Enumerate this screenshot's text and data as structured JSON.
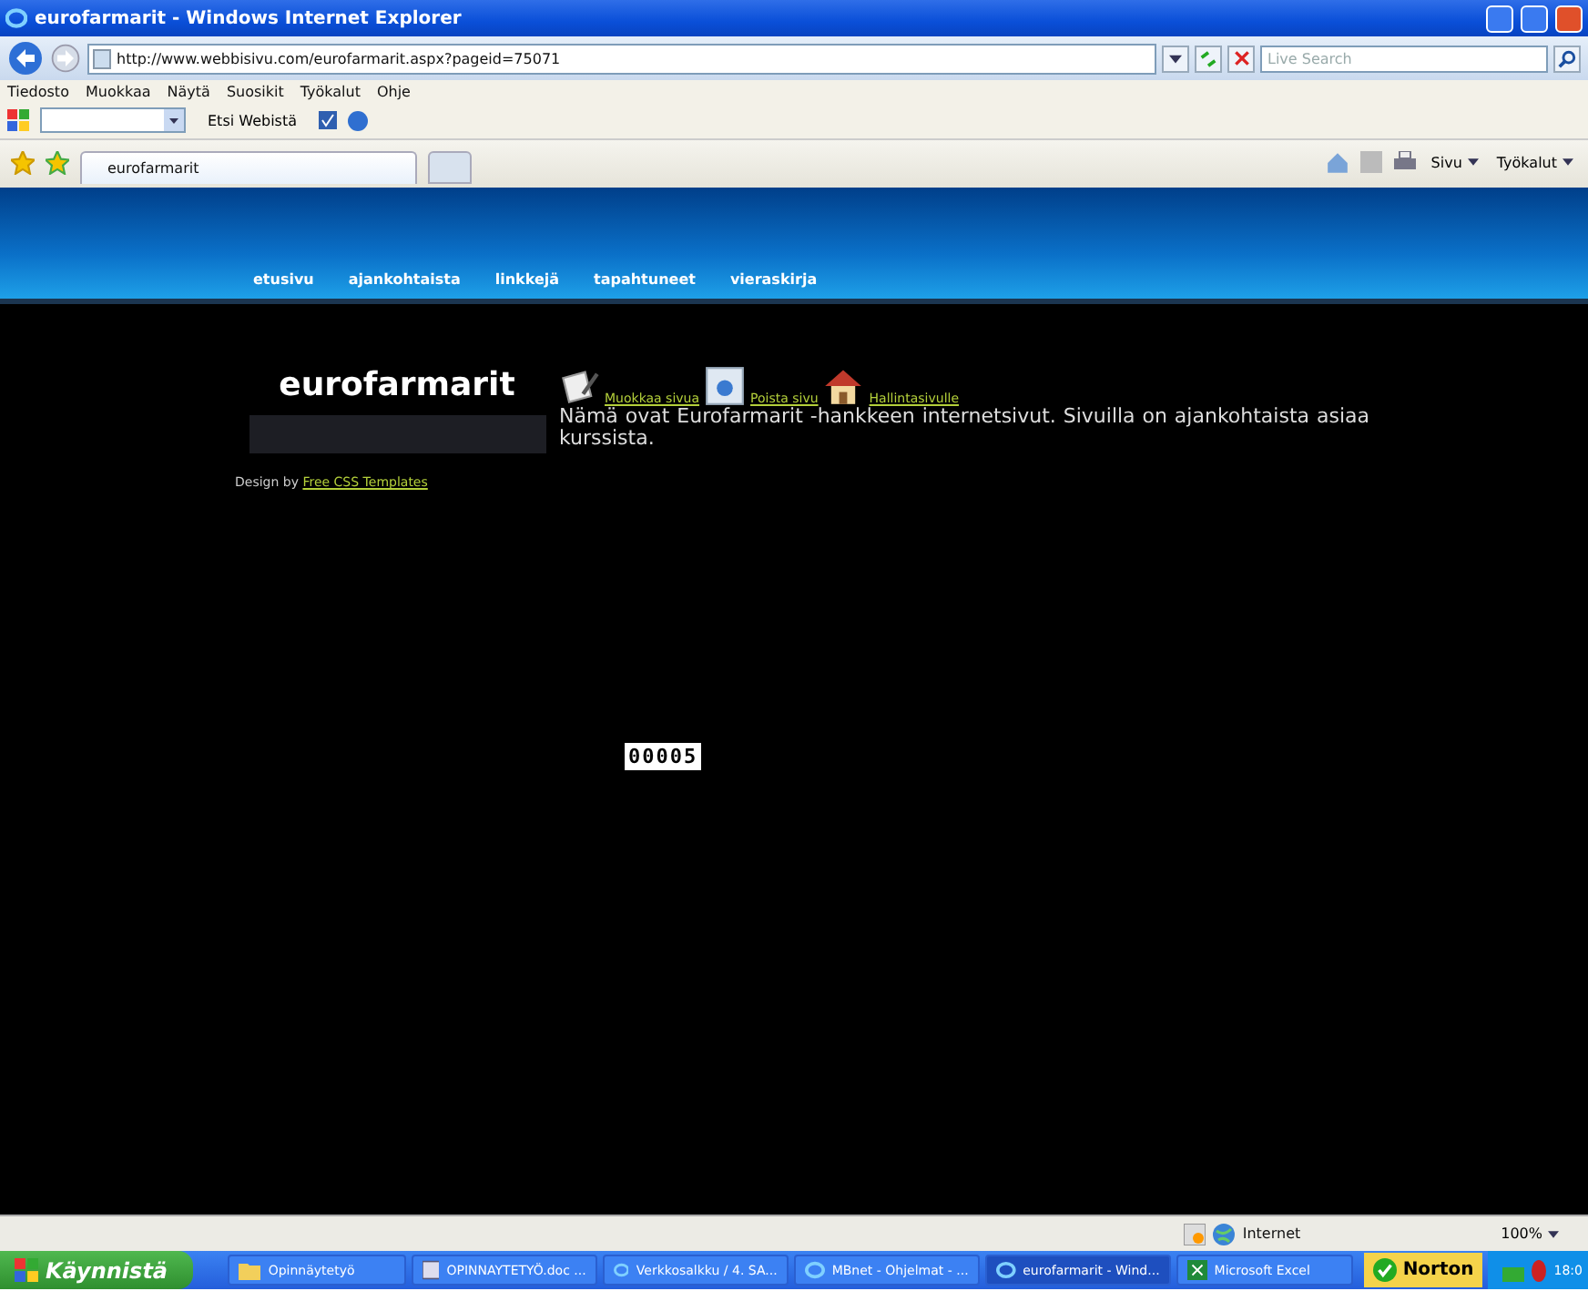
{
  "window": {
    "title": "eurofarmarit - Windows Internet Explorer"
  },
  "address_bar": {
    "url": "http://www.webbisivu.com/eurofarmarit.aspx?pageid=75071",
    "search_placeholder": "Live Search"
  },
  "menu": [
    "Tiedosto",
    "Muokkaa",
    "Näytä",
    "Suosikit",
    "Työkalut",
    "Ohje"
  ],
  "links_toolbar": {
    "search_label": "Etsi Webistä"
  },
  "tabs": [
    {
      "label": "eurofarmarit",
      "selected": true
    }
  ],
  "command_bar": [
    "Sivu",
    "Työkalut"
  ],
  "page": {
    "nav": [
      "etusivu",
      "ajankohtaista",
      "linkkejä",
      "tapahtuneet",
      "vieraskirja"
    ],
    "site_title": "eurofarmarit",
    "credit_prefix": "Design by",
    "credit_link": "Free CSS Templates",
    "actions": [
      {
        "kind": "edit",
        "label": "Muokkaa sivua"
      },
      {
        "kind": "delete",
        "label": "Poista sivu"
      },
      {
        "kind": "home",
        "label": "Hallintasivulle"
      }
    ],
    "intro": "Nämä ovat Eurofarmarit -hankkeen internetsivut. Sivuilla on ajankohtaista asiaa kurssista.",
    "counter": "00005"
  },
  "status_bar": {
    "zone": "Internet",
    "zoom": "100%"
  },
  "taskbar": {
    "start": "Käynnistä",
    "items": [
      {
        "kind": "folder",
        "label": "Opinnäytetyö",
        "selected": false
      },
      {
        "kind": "doc",
        "label": "OPINNAYTETYÖ.doc ...",
        "selected": false
      },
      {
        "kind": "ie",
        "label": "Verkkosalkku / 4. SA...",
        "selected": false
      },
      {
        "kind": "ie",
        "label": "MBnet - Ohjelmat - ...",
        "selected": false
      },
      {
        "kind": "ie",
        "label": "eurofarmarit - Wind...",
        "selected": true
      },
      {
        "kind": "excel",
        "label": "Microsoft Excel",
        "selected": false
      }
    ],
    "tray_app": "Norton",
    "clock": "18:0"
  }
}
